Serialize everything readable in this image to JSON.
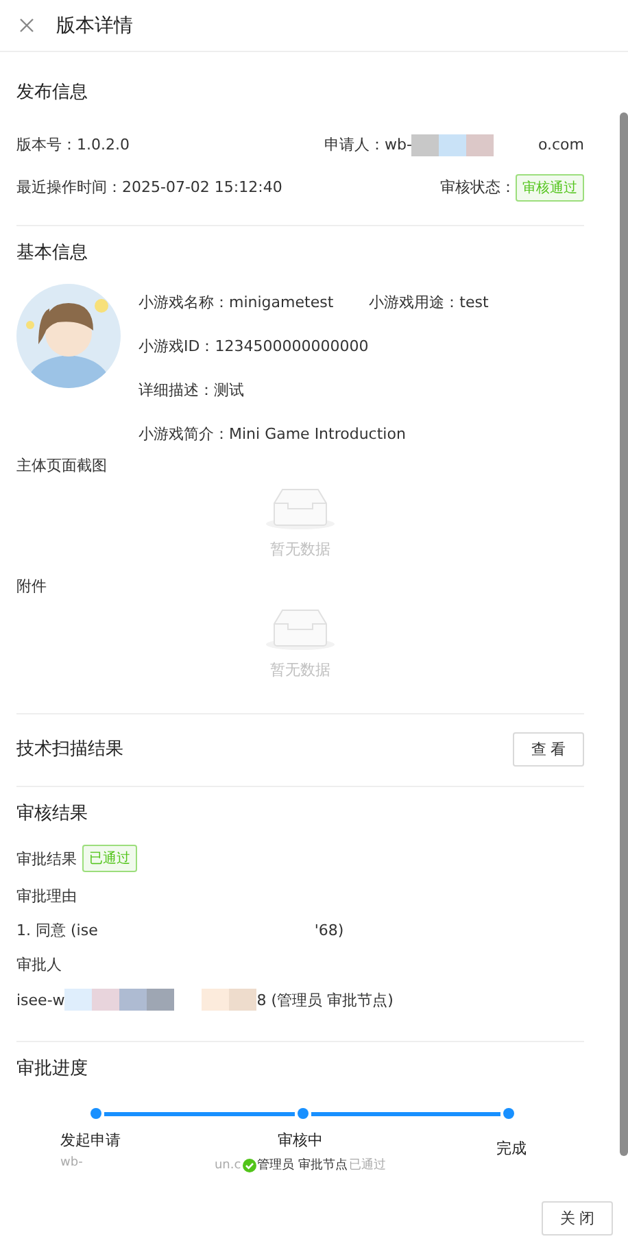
{
  "header": {
    "title": "版本详情"
  },
  "release": {
    "title": "发布信息",
    "fields": [
      {
        "label": "版本号：",
        "value": "1.0.2.0"
      },
      {
        "label": "申请人：",
        "value_prefix": "wb-",
        "value_suffix": "o.com"
      },
      {
        "label": "最近操作时间：",
        "value": "2025-07-02 15:12:40"
      },
      {
        "label": "审核状态：",
        "tag": "审核通过"
      }
    ]
  },
  "basic": {
    "title": "基本信息",
    "fields": [
      {
        "label": "小游戏名称：",
        "value": "minigametest"
      },
      {
        "label": "小游戏用途：",
        "value": "test"
      },
      {
        "label": "小游戏ID：",
        "value": "1234500000000000"
      },
      {
        "label": "详细描述：",
        "value": "测试"
      },
      {
        "label": "小游戏简介：",
        "value": "Mini Game Introduction"
      }
    ],
    "attachments": [
      {
        "label": "主体页面截图",
        "empty_text": "暂无数据"
      },
      {
        "label": "附件",
        "empty_text": "暂无数据"
      }
    ]
  },
  "scan": {
    "title": "技术扫描结果",
    "button": "查 看"
  },
  "review": {
    "title": "审核结果",
    "result_label": "审批结果",
    "result_tag": "已通过",
    "reason_label": "审批理由",
    "reason_prefix": "1. 同意 (ise",
    "reason_suffix": "'68)",
    "approver_label": "审批人",
    "approver_prefix": "isee-w",
    "approver_suffix": "8 (管理员 审批节点)"
  },
  "progress": {
    "title": "审批进度",
    "steps": [
      {
        "label": "发起申请",
        "detail": "wb-"
      },
      {
        "label": "审核中",
        "detail_prefix": "un.c",
        "detail": "管理员 审批节点",
        "detail_status": "已通过"
      },
      {
        "label": "完成"
      }
    ]
  },
  "footer": {
    "close_button": "关 闭"
  }
}
